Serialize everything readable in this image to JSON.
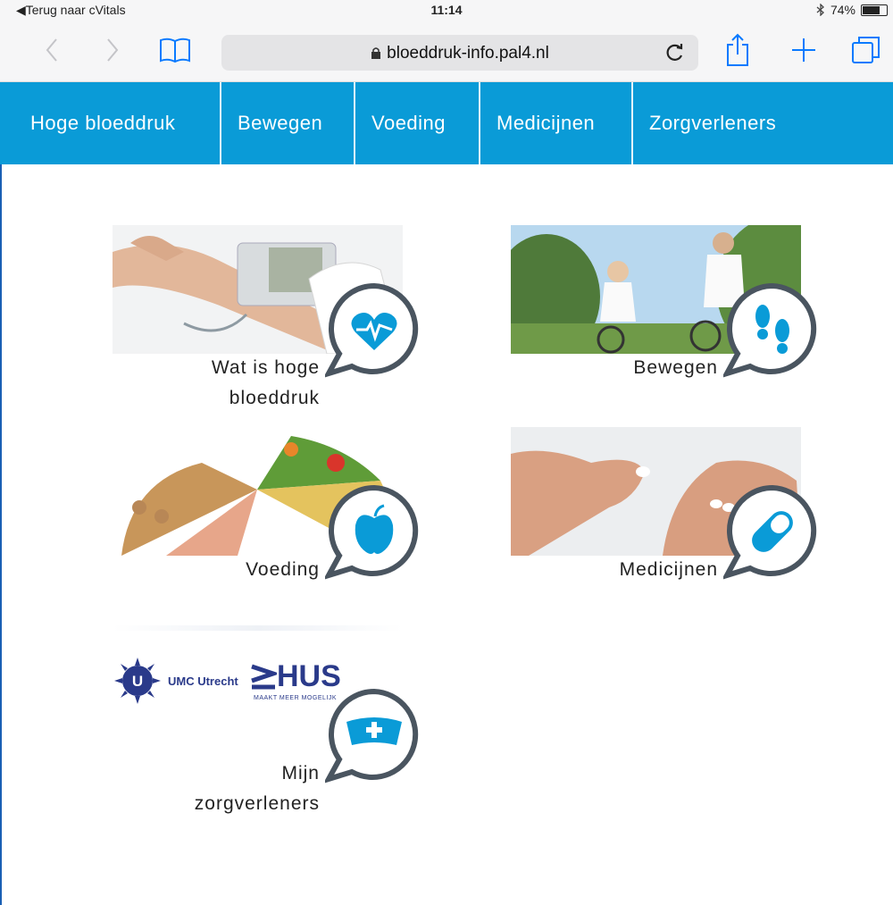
{
  "status_bar": {
    "back_app": "◀Terug naar cVitals",
    "time": "11:14",
    "battery": "74%",
    "battery_level": 0.74
  },
  "browser": {
    "url": "bloeddruk-info.pal4.nl"
  },
  "nav": {
    "items": [
      {
        "label": "Hoge bloeddruk"
      },
      {
        "label": "Bewegen"
      },
      {
        "label": "Voeding"
      },
      {
        "label": "Medicijnen"
      },
      {
        "label": "Zorgverleners"
      }
    ]
  },
  "tiles": [
    {
      "label_line1": "Wat is hoge",
      "label_line2": "bloeddruk",
      "icon": "heartbeat-icon"
    },
    {
      "label_line1": "Bewegen",
      "icon": "footprints-icon"
    },
    {
      "label_line1": "Voeding",
      "icon": "apple-icon"
    },
    {
      "label_line1": "Medicijnen",
      "icon": "pill-icon"
    },
    {
      "label_line1": "Mijn",
      "label_line2": "zorgverleners",
      "icon": "nurse-cap-icon"
    }
  ],
  "logos": {
    "umc": "UMC Utrecht",
    "hus": "HUS",
    "hus_tagline": "MAAKT MEER MOGELIJK"
  },
  "colors": {
    "brand": "#0a9bd7",
    "bubble_border": "#4a5560"
  }
}
